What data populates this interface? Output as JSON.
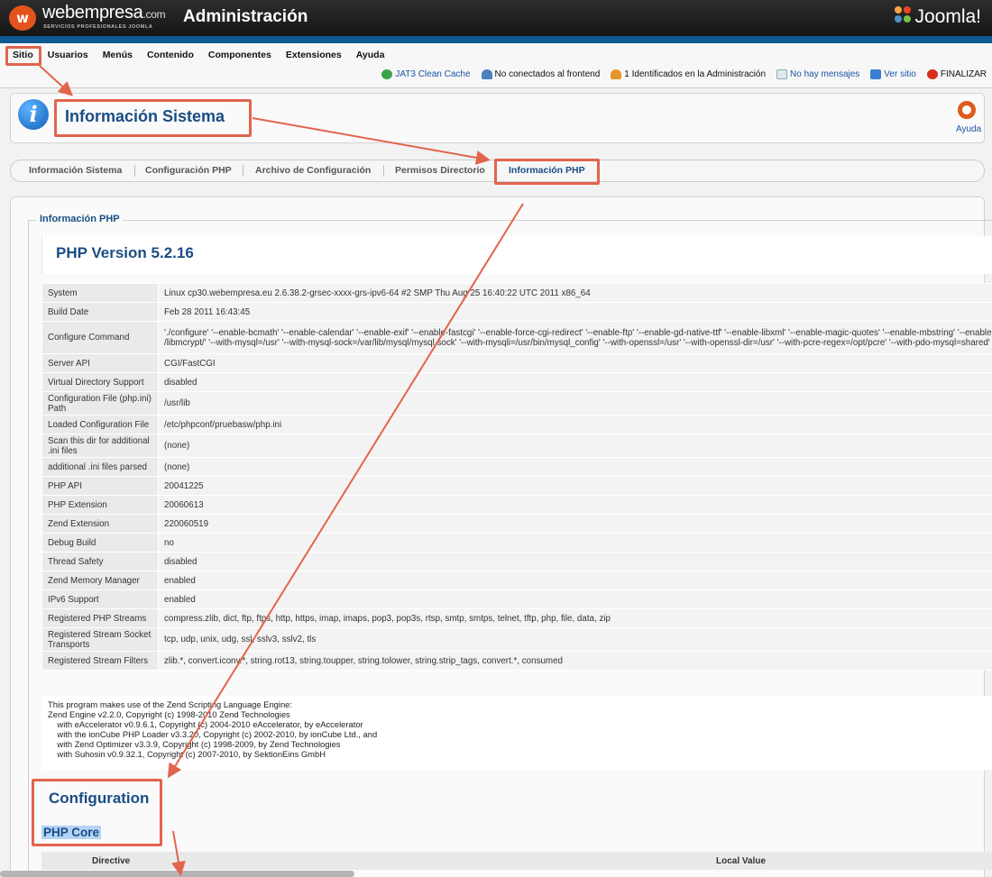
{
  "header": {
    "logo_mark": "w",
    "brand": "webempresa",
    "brand_suffix": ".com",
    "brand_tagline": "SERVICIOS PROFESIONALES JOOMLA",
    "title": "Administración",
    "cms_logo": "Joomla!"
  },
  "menu": [
    "Sitio",
    "Usuarios",
    "Menús",
    "Contenido",
    "Componentes",
    "Extensiones",
    "Ayuda"
  ],
  "status": {
    "cache": "JAT3 Clean Cache",
    "frontend": "No conectados al frontend",
    "admins": "1 Identificados en la Administración",
    "messages": "No hay mensajes",
    "view_site": "Ver sitio",
    "logout": "FINALIZAR"
  },
  "page": {
    "title": "Información Sistema",
    "help": "Ayuda"
  },
  "tabs": [
    "Información Sistema",
    "Configuración PHP",
    "Archivo de Configuración",
    "Permisos Directorio",
    "Información PHP"
  ],
  "active_tab": "Información PHP",
  "phpinfo": {
    "legend": "Información PHP",
    "version": "PHP Version 5.2.16",
    "rows": [
      {
        "k": "System",
        "v": "Linux cp30.webempresa.eu 2.6.38.2-grsec-xxxx-grs-ipv6-64 #2 SMP Thu Aug 25 16:40:22 UTC 2011 x86_64"
      },
      {
        "k": "Build Date",
        "v": "Feb 28 2011 16:43:45"
      },
      {
        "k": "Configure Command",
        "v": "'./configure' '--enable-bcmath' '--enable-calendar' '--enable-exif' '--enable-fastcgi' '--enable-force-cgi-redirect' '--enable-ftp' '--enable-gd-native-ttf' '--enable-libxml' '--enable-magic-quotes' '--enable-mbstring' '--enable-pdo=s",
        "v2": "/libmcrypt/' '--with-mysql=/usr' '--with-mysql-sock=/var/lib/mysql/mysql.sock' '--with-mysqli=/usr/bin/mysql_config' '--with-openssl=/usr' '--with-openssl-dir=/usr' '--with-pcre-regex=/opt/pcre' '--with-pdo-mysql=shared' '--with-"
      },
      {
        "k": "Server API",
        "v": "CGI/FastCGI"
      },
      {
        "k": "Virtual Directory Support",
        "v": "disabled"
      },
      {
        "k": "Configuration File (php.ini) Path",
        "v": "/usr/lib"
      },
      {
        "k": "Loaded Configuration File",
        "v": "/etc/phpconf/pruebasw/php.ini"
      },
      {
        "k": "Scan this dir for additional .ini files",
        "v": "(none)"
      },
      {
        "k": "additional .ini files parsed",
        "v": "(none)"
      },
      {
        "k": "PHP API",
        "v": "20041225"
      },
      {
        "k": "PHP Extension",
        "v": "20060613"
      },
      {
        "k": "Zend Extension",
        "v": "220060519"
      },
      {
        "k": "Debug Build",
        "v": "no"
      },
      {
        "k": "Thread Safety",
        "v": "disabled"
      },
      {
        "k": "Zend Memory Manager",
        "v": "enabled"
      },
      {
        "k": "IPv6 Support",
        "v": "enabled"
      },
      {
        "k": "Registered PHP Streams",
        "v": "compress.zlib, dict, ftp, ftps, http, https, imap, imaps, pop3, pop3s, rtsp, smtp, smtps, telnet, tftp, php, file, data, zip"
      },
      {
        "k": "Registered Stream Socket Transports",
        "v": "tcp, udp, unix, udg, ssl, sslv3, sslv2, tls"
      },
      {
        "k": "Registered Stream Filters",
        "v": "zlib.*, convert.iconv.*, string.rot13, string.toupper, string.tolower, string.strip_tags, convert.*, consumed"
      }
    ],
    "credits": [
      "This program makes use of the Zend Scripting Language Engine:",
      "Zend Engine v2.2.0, Copyright (c) 1998-2010 Zend Technologies",
      "    with eAccelerator v0.9.6.1, Copyright (c) 2004-2010 eAccelerator, by eAccelerator",
      "    with the ionCube PHP Loader v3.3.20, Copyright (c) 2002-2010, by ionCube Ltd., and",
      "    with Zend Optimizer v3.3.9, Copyright (c) 1998-2009, by Zend Technologies",
      "    with Suhosin v0.9.32.1, Copyright (c) 2007-2010, by SektionEins GmbH"
    ],
    "config_title": "Configuration",
    "core_title": "PHP Core",
    "col_directive": "Directive",
    "col_local": "Local Value"
  },
  "colors": {
    "topbar": "#1f1f1f",
    "accent_blue": "#0f5a91",
    "title_blue": "#1a4d84",
    "annotation": "#e2644d",
    "brand_orange": "#e4531c"
  }
}
